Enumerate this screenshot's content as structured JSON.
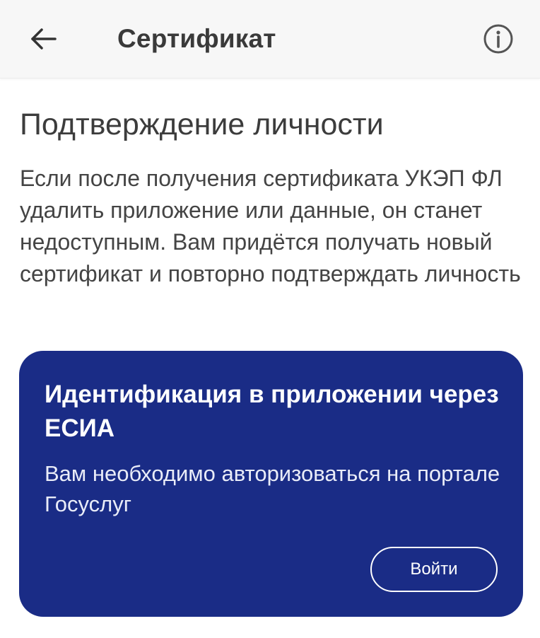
{
  "app_bar": {
    "title": "Сертификат",
    "back_icon": "arrow-left-icon",
    "info_icon": "info-circle-icon"
  },
  "section": {
    "heading": "Подтверждение личности",
    "body": "Если после получения сертификата УКЭП ФЛ удалить приложение или данные, он станет недоступным. Вам придётся получать новый сертификат и повторно подтверждать личность"
  },
  "esia_card": {
    "title": "Идентификация в приложении через ЕСИА",
    "body": "Вам необходимо авторизоваться на портале Госуслуг",
    "button_label": "Войти"
  },
  "colors": {
    "card_background": "#1a2c86",
    "app_bar_background": "#f7f7f7",
    "text_primary": "#3a3a3a"
  }
}
